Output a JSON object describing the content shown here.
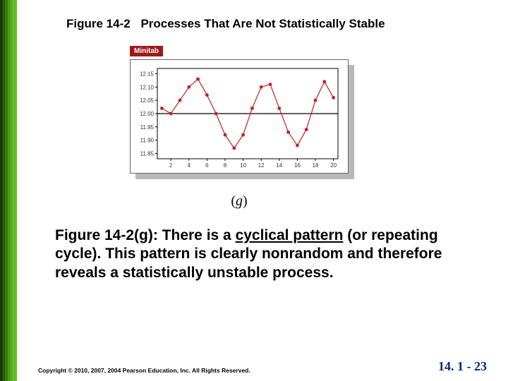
{
  "title": {
    "figure_label": "Figure 14-2",
    "figure_title": "Processes That Are Not Statistically Stable"
  },
  "minitab_badge": "Minitab",
  "panel_label": "g",
  "description": {
    "lead": "Figure 14-2(g): There is a ",
    "underlined": "cyclical pattern",
    "rest": " (or repeating cycle).  This pattern is clearly nonrandom and therefore reveals a statistically unstable process."
  },
  "footer": {
    "copyright": "Copyright © 2010, 2007, 2004 Pearson Education, Inc. All Rights Reserved.",
    "page_number": "14. 1 - 23"
  },
  "chart_data": {
    "type": "line",
    "xlabel": "",
    "ylabel": "",
    "xlim": [
      0.5,
      20.5
    ],
    "ylim": [
      11.83,
      12.17
    ],
    "x_ticks": [
      2,
      4,
      6,
      8,
      10,
      12,
      14,
      16,
      18,
      20
    ],
    "y_ticks": [
      11.85,
      11.9,
      11.95,
      12.0,
      12.05,
      12.1,
      12.15
    ],
    "centerline": 12.0,
    "x": [
      1,
      2,
      3,
      4,
      5,
      6,
      7,
      8,
      9,
      10,
      11,
      12,
      13,
      14,
      15,
      16,
      17,
      18,
      19,
      20
    ],
    "values": [
      12.02,
      12.0,
      12.05,
      12.1,
      12.13,
      12.07,
      12.0,
      11.92,
      11.87,
      11.92,
      12.02,
      12.1,
      12.11,
      12.02,
      11.93,
      11.88,
      11.94,
      12.05,
      12.12,
      12.06
    ]
  }
}
